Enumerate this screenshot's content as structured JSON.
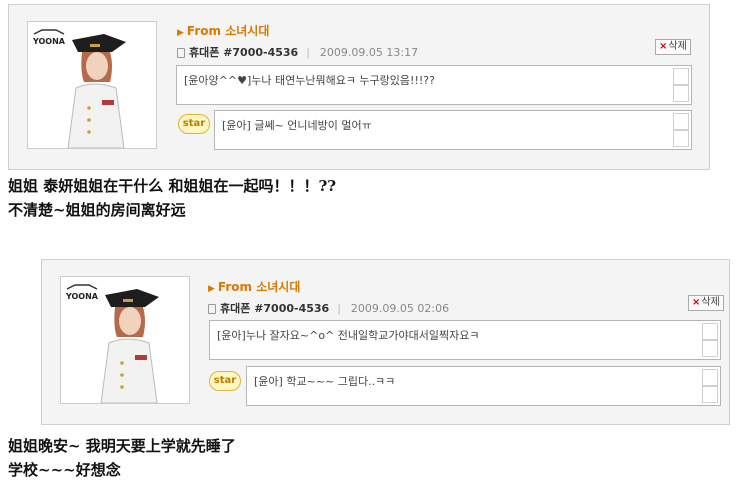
{
  "posts": [
    {
      "from_label": "From 소녀시대",
      "author": "휴대폰 #7000-4536",
      "date": "2009.09.05 13:17",
      "delete_label": "삭제",
      "badge_label": "star",
      "photo_logo": "YOONA",
      "comment": "[윤아양^^♥]누나 태연누난뭐해요ㅋ 누구랑있음!!!??",
      "reply": "[윤아] 글쎄~ 언니네방이 멀어ㅠ"
    },
    {
      "from_label": "From 소녀시대",
      "author": "휴대폰 #7000-4536",
      "date": "2009.09.05 02:06",
      "delete_label": "삭제",
      "badge_label": "star",
      "photo_logo": "YOONA",
      "comment": "[윤아]누나 잘자요~^o^ 전내일학교가야대서일찍자요ㅋ",
      "reply": "[윤아] 학교~~~ 그립다..ㅋㅋ"
    }
  ],
  "captions": [
    "姐姐 泰妍姐姐在干什么 和姐姐在一起吗！！！??",
    "不清楚~姐姐的房间离好远",
    "姐姐晚安~ 我明天要上学就先睡了",
    "学校~~~好想念"
  ]
}
